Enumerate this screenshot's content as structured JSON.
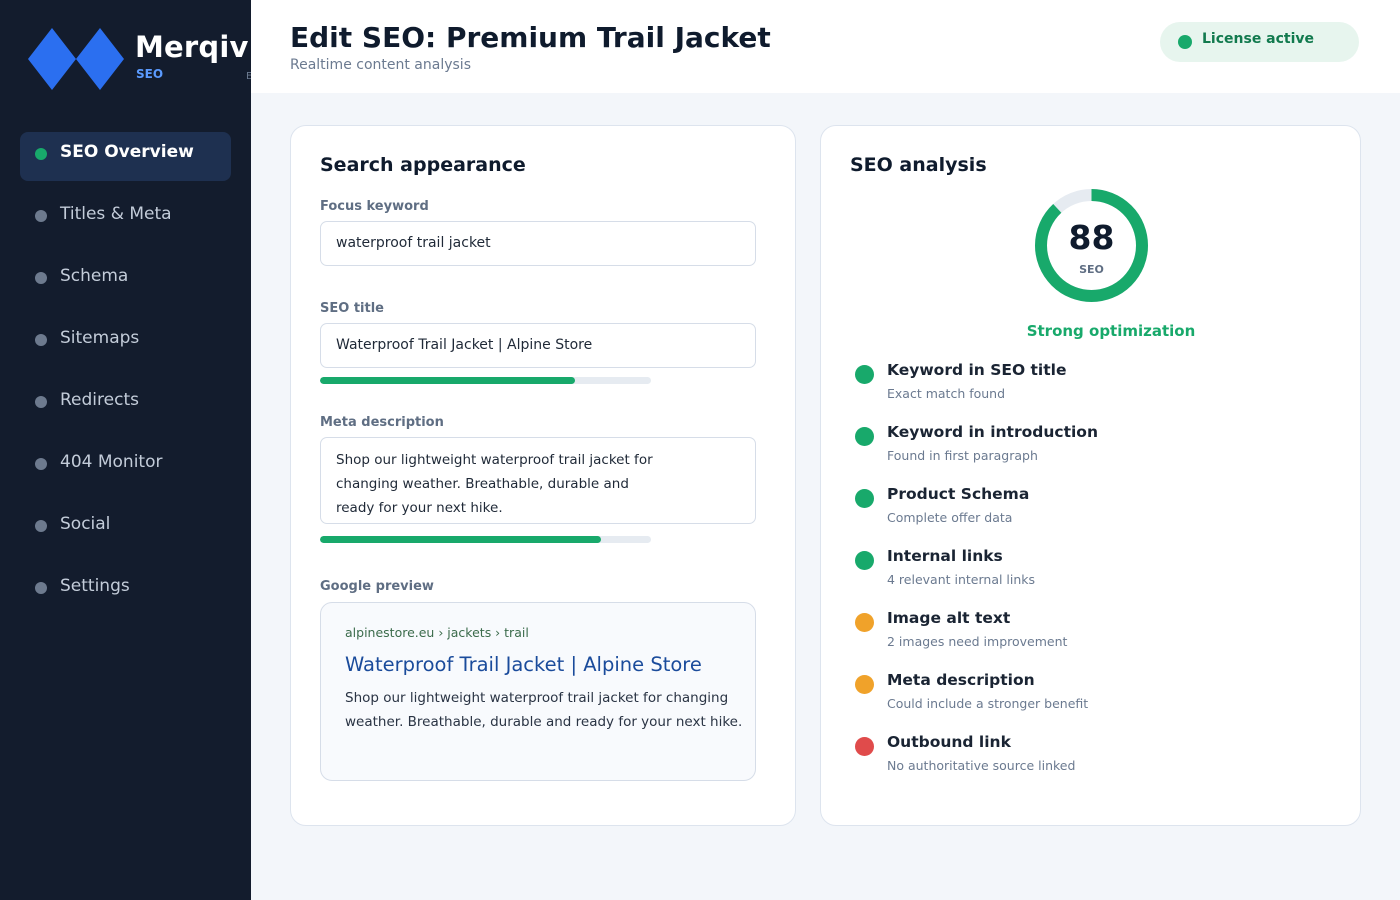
{
  "brand": {
    "name": "Merqivi",
    "sub": "SEO",
    "ghost": "E"
  },
  "sidebar": {
    "items": [
      {
        "label": "SEO Overview",
        "active": true
      },
      {
        "label": "Titles & Meta"
      },
      {
        "label": "Schema"
      },
      {
        "label": "Sitemaps"
      },
      {
        "label": "Redirects"
      },
      {
        "label": "404 Monitor"
      },
      {
        "label": "Social"
      },
      {
        "label": "Settings"
      }
    ]
  },
  "header": {
    "title": "Edit SEO: Premium Trail Jacket",
    "subtitle": "Realtime content analysis",
    "license_label": "License active"
  },
  "search_appearance": {
    "title": "Search appearance",
    "focus_keyword": {
      "label": "Focus keyword",
      "value": "waterproof trail jacket"
    },
    "seo_title": {
      "label": "SEO title",
      "value": "Waterproof Trail Jacket | Alpine Store",
      "progress_percent": 77
    },
    "meta_description": {
      "label": "Meta description",
      "value": "Shop our lightweight waterproof trail jacket for changing weather. Breathable, durable and ready for your next hike.",
      "progress_percent": 85
    },
    "google_preview": {
      "label": "Google preview",
      "url": "alpinestore.eu › jackets › trail",
      "title": "Waterproof Trail Jacket | Alpine Store",
      "description": "Shop our lightweight waterproof trail jacket for changing weather. Breathable, durable and ready for your next hike."
    }
  },
  "seo_analysis": {
    "title": "SEO analysis",
    "score": "88",
    "score_label": "SEO",
    "score_max": 100,
    "status": "Strong optimization",
    "colors": {
      "good": "#18a96b",
      "warning": "#f0a22a",
      "bad": "#e04b4b",
      "track": "#e6ebf1"
    },
    "checks": [
      {
        "title": "Keyword in SEO title",
        "description": "Exact match found",
        "status": "good"
      },
      {
        "title": "Keyword in introduction",
        "description": "Found in first paragraph",
        "status": "good"
      },
      {
        "title": "Product Schema",
        "description": "Complete offer data",
        "status": "good"
      },
      {
        "title": "Internal links",
        "description": "4 relevant internal links",
        "status": "good"
      },
      {
        "title": "Image alt text",
        "description": "2 images need improvement",
        "status": "warning"
      },
      {
        "title": "Meta description",
        "description": "Could include a stronger benefit",
        "status": "warning"
      },
      {
        "title": "Outbound link",
        "description": "No authoritative source linked",
        "status": "bad"
      }
    ]
  }
}
